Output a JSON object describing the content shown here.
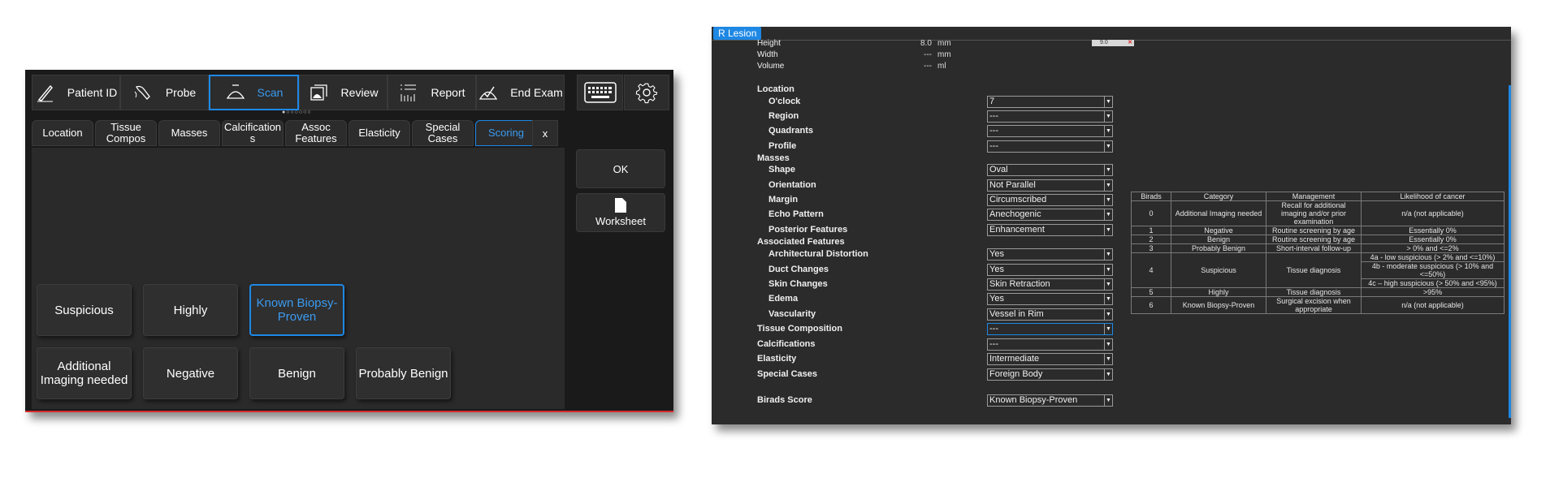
{
  "left": {
    "toolbar": [
      {
        "label": "Patient ID",
        "icon": "pen-icon"
      },
      {
        "label": "Probe",
        "icon": "probe-icon"
      },
      {
        "label": "Scan",
        "icon": "scan-icon",
        "active": true
      },
      {
        "label": "Review",
        "icon": "review-icon"
      },
      {
        "label": "Report",
        "icon": "report-icon"
      },
      {
        "label": "End Exam",
        "icon": "end-exam-icon"
      }
    ],
    "page_dots": "●○○○○○○",
    "tabs": [
      "Location",
      "Tissue Compos",
      "Masses",
      "Calcification s",
      "Assoc Features",
      "Elasticity",
      "Special Cases",
      "Scoring"
    ],
    "active_tab": "Scoring",
    "close_label": "x",
    "ok_label": "OK",
    "worksheet_label": "Worksheet",
    "scores_row1": [
      "Suspicious",
      "Highly",
      "Known Biopsy-Proven"
    ],
    "scores_row2": [
      "Additional Imaging needed",
      "Negative",
      "Benign",
      "Probably Benign"
    ],
    "selected_score": "Known Biopsy-Proven",
    "accent_color": "#1e88e5",
    "border_accent": "#d62b2b"
  },
  "right": {
    "title": "R Lesion",
    "measurements": [
      {
        "label": "Height",
        "value": "8.0",
        "unit": "mm"
      },
      {
        "label": "Width",
        "value": "---",
        "unit": "mm"
      },
      {
        "label": "Volume",
        "value": "---",
        "unit": "ml"
      }
    ],
    "small_field": "9.0",
    "form": {
      "location": "Location",
      "oclock": {
        "label": "O'clock",
        "value": "7"
      },
      "region": {
        "label": "Region",
        "value": "---"
      },
      "quadrants": {
        "label": "Quadrants",
        "value": "---"
      },
      "profile": {
        "label": "Profile",
        "value": "---"
      },
      "masses": "Masses",
      "shape": {
        "label": "Shape",
        "value": "Oval"
      },
      "orientation": {
        "label": "Orientation",
        "value": "Not Parallel"
      },
      "margin": {
        "label": "Margin",
        "value": "Circumscribed"
      },
      "echo": {
        "label": "Echo Pattern",
        "value": "Anechogenic"
      },
      "posterior": {
        "label": "Posterior Features",
        "value": "Enhancement"
      },
      "assoc": "Associated Features",
      "arch": {
        "label": "Architectural Distortion",
        "value": "Yes"
      },
      "duct": {
        "label": "Duct Changes",
        "value": "Yes"
      },
      "skin": {
        "label": "Skin Changes",
        "value": "Skin Retraction"
      },
      "edema": {
        "label": "Edema",
        "value": "Yes"
      },
      "vascularity": {
        "label": "Vascularity",
        "value": "Vessel in Rim"
      },
      "tissue": {
        "label": "Tissue Composition",
        "value": "---"
      },
      "calc": {
        "label": "Calcifications",
        "value": "---"
      },
      "elasticity": {
        "label": "Elasticity",
        "value": "Intermediate"
      },
      "special": {
        "label": "Special Cases",
        "value": "Foreign Body"
      },
      "birads": {
        "label": "Birads Score",
        "value": "Known Biopsy-Proven"
      }
    },
    "table": {
      "headers": [
        "Birads",
        "Category",
        "Management",
        "Likelihood of cancer"
      ],
      "rows": [
        {
          "birads": "0",
          "category": "Additional Imaging needed",
          "management": "Recall for additional imaging and/or prior examination",
          "likelihood": "n/a (not applicable)"
        },
        {
          "birads": "1",
          "category": "Negative",
          "management": "Routine screening by age",
          "likelihood": "Essentially 0%"
        },
        {
          "birads": "2",
          "category": "Benign",
          "management": "Routine screening by age",
          "likelihood": "Essentially 0%"
        },
        {
          "birads": "3",
          "category": "Probably Benign",
          "management": "Short-interval follow-up",
          "likelihood": "> 0% and <=2%"
        },
        {
          "birads": "4",
          "category": "Suspicious",
          "management": "Tissue diagnosis",
          "likelihood_4a": "4a - low suspicious (> 2% and <=10%)",
          "likelihood_4b": "4b - moderate suspicious (> 10% and <=50%)",
          "likelihood_4c": "4c – high suspicious (> 50% and <95%)"
        },
        {
          "birads": "5",
          "category": "Highly",
          "management": "Tissue diagnosis",
          "likelihood": ">95%"
        },
        {
          "birads": "6",
          "category": "Known Biopsy-Proven",
          "management": "Surgical excision when appropriate",
          "likelihood": "n/a (not applicable)"
        }
      ]
    }
  }
}
